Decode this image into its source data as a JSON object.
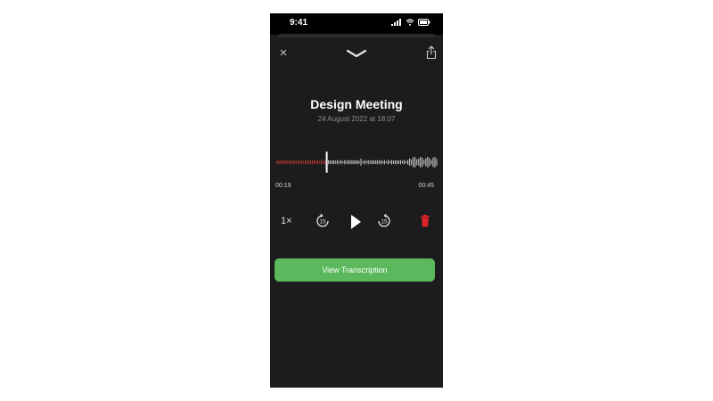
{
  "status_bar": {
    "time": "9:41"
  },
  "header": {
    "close_icon": "close-icon",
    "chevron_icon": "chevron-down-icon",
    "share_icon": "share-icon"
  },
  "recording": {
    "title": "Design Meeting",
    "date": "24 August 2022 at 18:07",
    "current_time": "00:19",
    "remaining_time": "00:45",
    "progress": 0.3
  },
  "controls": {
    "speed_label": "1×",
    "skip_back_seconds": "15",
    "skip_forward_seconds": "15",
    "play_icon": "play-icon",
    "delete_icon": "trash-icon"
  },
  "actions": {
    "view_transcription_label": "View Transcription"
  },
  "colors": {
    "accent_green": "#5cb85c",
    "played_red": "#c0392b",
    "delete_red": "#e0242a",
    "background": "#1c1c1e"
  }
}
